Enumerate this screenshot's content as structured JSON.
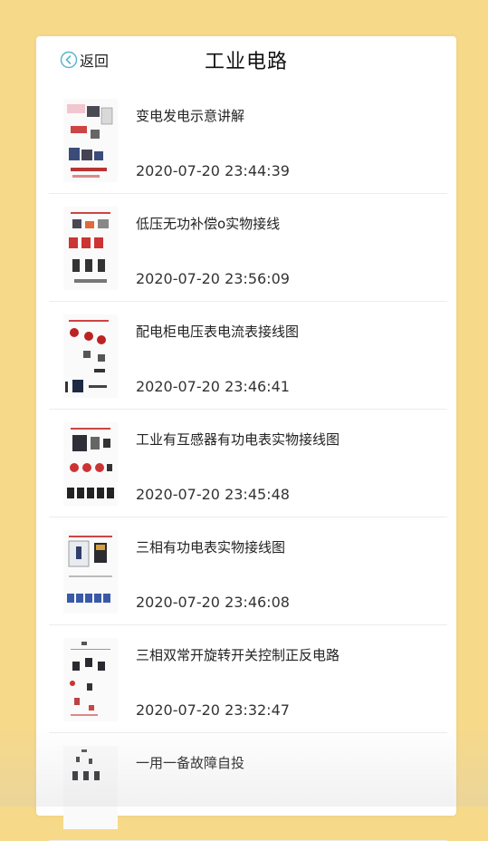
{
  "header": {
    "back_label": "返回",
    "title": "工业电路"
  },
  "items": [
    {
      "title": "变电发电示意讲解",
      "time": "2020-07-20 23:44:39"
    },
    {
      "title": "低压无功补偿o实物接线",
      "time": "2020-07-20 23:56:09"
    },
    {
      "title": "配电柜电压表电流表接线图",
      "time": "2020-07-20 23:46:41"
    },
    {
      "title": "工业有互感器有功电表实物接线图",
      "time": "2020-07-20 23:45:48"
    },
    {
      "title": "三相有功电表实物接线图",
      "time": "2020-07-20 23:46:08"
    },
    {
      "title": "三相双常开旋转开关控制正反电路",
      "time": "2020-07-20 23:32:47"
    },
    {
      "title": "一用一备故障自投",
      "time": ""
    }
  ],
  "colors": {
    "background": "#f7d98a",
    "accent": "#5bb5c8"
  },
  "icons": {
    "back": "back-circle-arrow-icon"
  }
}
